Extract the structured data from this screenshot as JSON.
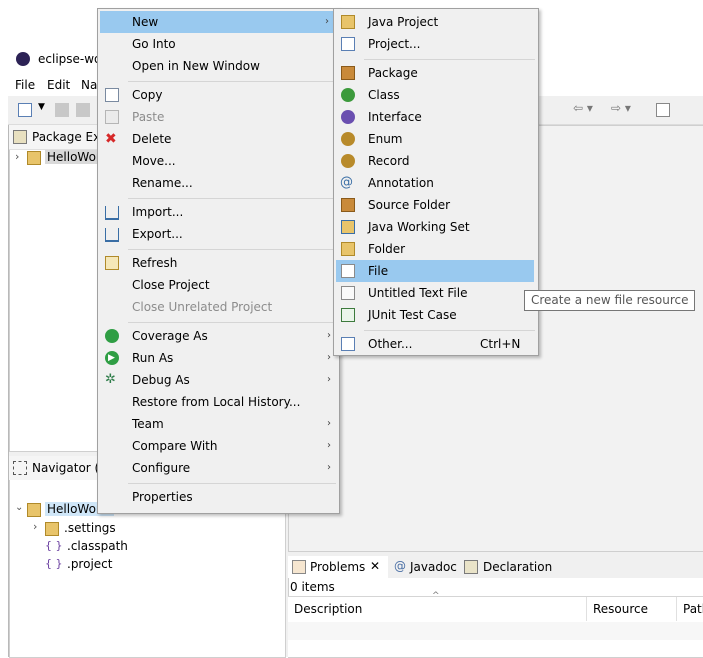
{
  "window": {
    "title": "eclipse-wor",
    "menu": [
      "File",
      "Edit",
      "Na"
    ]
  },
  "left": {
    "package_explorer_title": "Package Exp",
    "project_name": "HelloWorld",
    "navigator_title": "Navigator (D",
    "navigator_items": [
      ".settings",
      ".classpath",
      ".project"
    ]
  },
  "bottom": {
    "tabs": [
      "Problems",
      "Javadoc",
      "Declaration"
    ],
    "count": "0 items",
    "columns": [
      "Description",
      "Resource",
      "Path"
    ]
  },
  "context_menu": {
    "items": [
      "New",
      "Go Into",
      "Open in New Window",
      "Copy",
      "Paste",
      "Delete",
      "Move...",
      "Rename...",
      "Import...",
      "Export...",
      "Refresh",
      "Close Project",
      "Close Unrelated Project",
      "Coverage As",
      "Run As",
      "Debug As",
      "Restore from Local History...",
      "Team",
      "Compare With",
      "Configure",
      "Properties"
    ]
  },
  "submenu": {
    "items": [
      "Java Project",
      "Project...",
      "Package",
      "Class",
      "Interface",
      "Enum",
      "Record",
      "Annotation",
      "Source Folder",
      "Java Working Set",
      "Folder",
      "File",
      "Untitled Text File",
      "JUnit Test Case",
      "Other..."
    ],
    "other_shortcut": "Ctrl+N"
  },
  "tooltip": "Create a new file resource",
  "colors": {
    "highlight": "#99c9ef",
    "menu_bg": "#f0f0f0",
    "disabled_text": "#8c8c8c"
  }
}
